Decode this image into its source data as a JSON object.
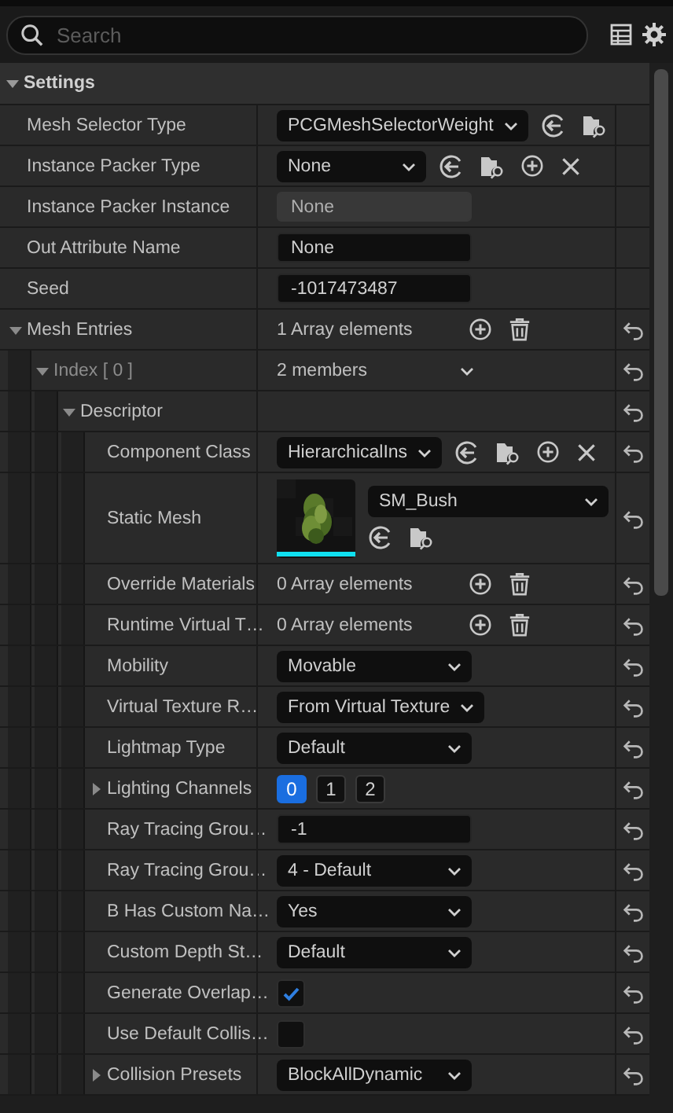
{
  "search": {
    "placeholder": "Search"
  },
  "categories": [
    {
      "label": "Settings",
      "expanded": true,
      "properties": [
        {
          "label": "Mesh Selector Type",
          "kind": "combo",
          "value": "PCGMeshSelectorWeight",
          "buttons": [
            {
              "kind": "use"
            },
            {
              "kind": "browse"
            }
          ]
        },
        {
          "label": "Instance Packer Type",
          "kind": "combo",
          "value": "None",
          "buttons": [
            {
              "kind": "use"
            },
            {
              "kind": "browse"
            },
            {
              "kind": "add"
            },
            {
              "kind": "clear"
            }
          ]
        },
        {
          "label": "Instance Packer Instance",
          "kind": "readonly",
          "value": "None"
        },
        {
          "label": "Out Attribute Name",
          "kind": "text",
          "value": "None"
        },
        {
          "label": "Seed",
          "kind": "text",
          "value": "-1017473487"
        },
        {
          "label": "Mesh Entries",
          "kind": "array",
          "value": "1 Array elements",
          "buttons": [
            {
              "kind": "add"
            },
            {
              "kind": "delete"
            }
          ],
          "reset": true,
          "expanded": true,
          "children": [
            {
              "label": "Index [ 0 ]",
              "kind": "members",
              "value": "2 members",
              "reset": true,
              "expanded": true,
              "children": [
                {
                  "label": "Descriptor",
                  "reset": true,
                  "expanded": true,
                  "children": [
                    {
                      "label": "Component Class",
                      "kind": "combo",
                      "value": "HierarchicalIns",
                      "buttons": [
                        {
                          "kind": "use"
                        },
                        {
                          "kind": "browse"
                        },
                        {
                          "kind": "add"
                        },
                        {
                          "kind": "clear"
                        }
                      ],
                      "reset": true
                    },
                    {
                      "label": "Static Mesh",
                      "kind": "asset",
                      "value": "SM_Bush",
                      "buttons": [
                        {
                          "kind": "use"
                        },
                        {
                          "kind": "browse"
                        }
                      ],
                      "reset": true
                    },
                    {
                      "label": "Override Materials",
                      "kind": "array",
                      "value": "0 Array elements",
                      "buttons": [
                        {
                          "kind": "add"
                        },
                        {
                          "kind": "delete"
                        }
                      ],
                      "reset": true
                    },
                    {
                      "label": "Runtime Virtual T…",
                      "kind": "array",
                      "value": "0 Array elements",
                      "buttons": [
                        {
                          "kind": "add"
                        },
                        {
                          "kind": "delete"
                        }
                      ],
                      "reset": true
                    },
                    {
                      "label": "Mobility",
                      "kind": "combo",
                      "value": "Movable",
                      "reset": true
                    },
                    {
                      "label": "Virtual Texture R…",
                      "kind": "combo",
                      "value": "From Virtual Texture",
                      "reset": true
                    },
                    {
                      "label": "Lightmap Type",
                      "kind": "combo",
                      "value": "Default",
                      "reset": true
                    },
                    {
                      "label": "Lighting Channels",
                      "kind": "channels",
                      "expanded": false,
                      "reset": true,
                      "channels": [
                        {
                          "label": "0",
                          "selected": true
                        },
                        {
                          "label": "1",
                          "selected": false
                        },
                        {
                          "label": "2",
                          "selected": false
                        }
                      ]
                    },
                    {
                      "label": "Ray Tracing Grou…",
                      "kind": "text",
                      "value": "-1",
                      "reset": true
                    },
                    {
                      "label": "Ray Tracing Grou…",
                      "kind": "combo",
                      "value": "4 - Default",
                      "reset": true
                    },
                    {
                      "label": "B Has Custom Na…",
                      "kind": "combo",
                      "value": "Yes",
                      "reset": true
                    },
                    {
                      "label": "Custom Depth St…",
                      "kind": "combo",
                      "value": "Default",
                      "reset": true
                    },
                    {
                      "label": "Generate Overlap…",
                      "kind": "checkbox",
                      "checked": true,
                      "reset": true
                    },
                    {
                      "label": "Use Default Collis…",
                      "kind": "checkbox",
                      "checked": false,
                      "reset": true
                    },
                    {
                      "label": "Collision Presets",
                      "kind": "combo",
                      "value": "BlockAllDynamic",
                      "expanded": false,
                      "reset": true
                    }
                  ]
                }
              ]
            }
          ]
        }
      ]
    }
  ]
}
